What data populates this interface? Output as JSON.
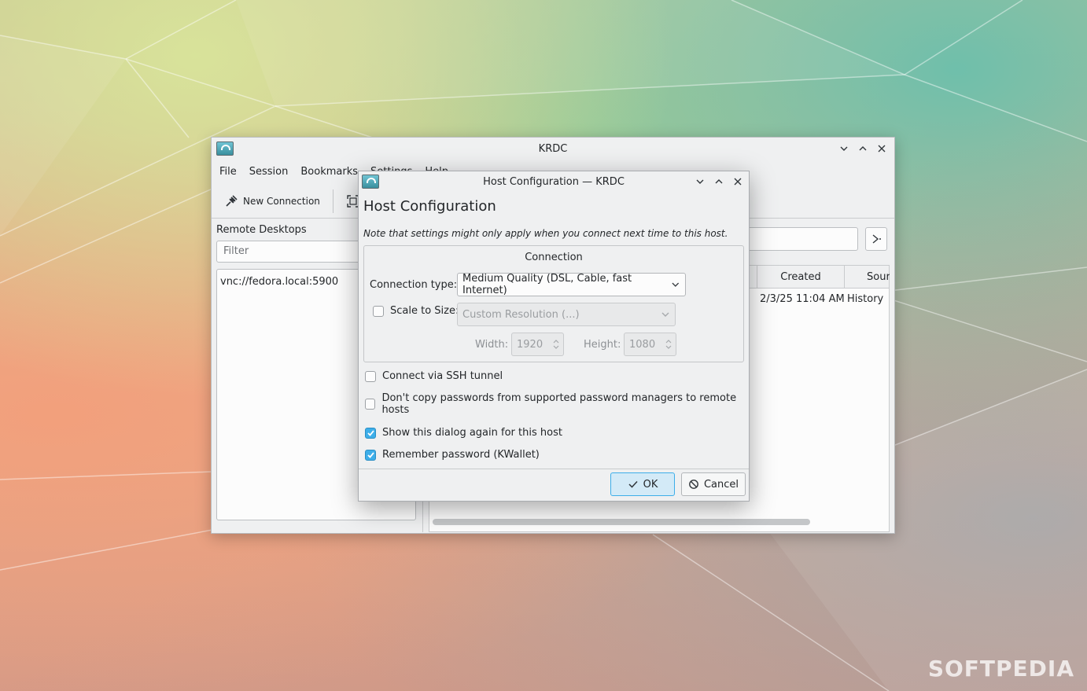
{
  "main_window": {
    "title": "KRDC",
    "menu": [
      "File",
      "Session",
      "Bookmarks",
      "Settings",
      "Help"
    ],
    "toolbar": {
      "new_connection": "New Connection"
    },
    "left_pane": {
      "title": "Remote Desktops",
      "filter_placeholder": "Filter",
      "items": [
        "vnc://fedora.local:5900"
      ]
    },
    "table": {
      "headers": [
        "Created",
        "Sour"
      ],
      "rows": [
        {
          "created": "2/3/25 11:04 AM",
          "source": "History"
        }
      ]
    }
  },
  "dialog": {
    "title": "Host Configuration — KRDC",
    "heading": "Host Configuration",
    "note": "Note that settings might only apply when you connect next time to this host.",
    "group_title": "Connection",
    "connection_type_label": "Connection type:",
    "connection_type_value": "Medium Quality (DSL, Cable, fast Internet)",
    "scale_label": "Scale to Size:",
    "scale_checked": false,
    "resolution_value": "Custom Resolution (...)",
    "width_label": "Width:",
    "width_value": "1920",
    "height_label": "Height:",
    "height_value": "1080",
    "ssh_label": "Connect via SSH tunnel",
    "ssh_checked": false,
    "nocopy_label": "Don't copy passwords from supported password managers to remote hosts",
    "nocopy_checked": false,
    "show_again_label": "Show this dialog again for this host",
    "show_again_checked": true,
    "remember_label": "Remember password (KWallet)",
    "remember_checked": true,
    "ok_label": "OK",
    "cancel_label": "Cancel"
  },
  "watermark": "SOFTPEDIA",
  "colors": {
    "accent": "#3daee9",
    "window_bg": "#eff0f1"
  }
}
